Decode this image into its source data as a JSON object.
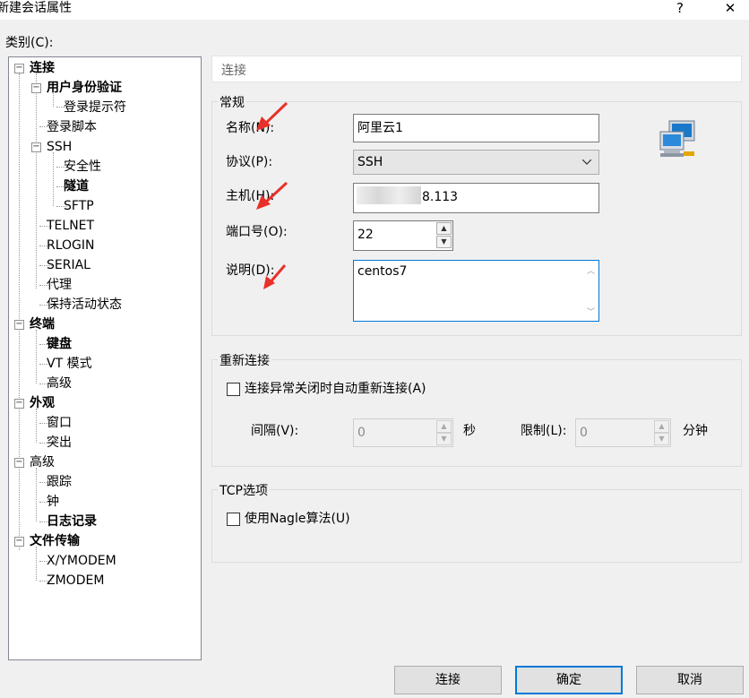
{
  "window": {
    "title": "新建会话属性",
    "help_glyph": "?",
    "close_glyph": "✕"
  },
  "category_label": "类别(C):",
  "tree": [
    {
      "label": "连接",
      "bold": true,
      "expander": "−"
    },
    {
      "label": "用户身份验证",
      "bold": true,
      "expander": "−"
    },
    {
      "label": "登录提示符",
      "bold": false
    },
    {
      "label": "登录脚本",
      "bold": false
    },
    {
      "label": "SSH",
      "bold": false,
      "expander": "−"
    },
    {
      "label": "安全性",
      "bold": false
    },
    {
      "label": "隧道",
      "bold": true
    },
    {
      "label": "SFTP",
      "bold": false
    },
    {
      "label": "TELNET",
      "bold": false
    },
    {
      "label": "RLOGIN",
      "bold": false
    },
    {
      "label": "SERIAL",
      "bold": false
    },
    {
      "label": "代理",
      "bold": false
    },
    {
      "label": "保持活动状态",
      "bold": false
    },
    {
      "label": "终端",
      "bold": true,
      "expander": "−"
    },
    {
      "label": "键盘",
      "bold": true
    },
    {
      "label": "VT 模式",
      "bold": false
    },
    {
      "label": "高级",
      "bold": false
    },
    {
      "label": "外观",
      "bold": true,
      "expander": "−"
    },
    {
      "label": "窗口",
      "bold": false
    },
    {
      "label": "突出",
      "bold": false
    },
    {
      "label": "高级",
      "bold": false,
      "expander": "−"
    },
    {
      "label": "跟踪",
      "bold": false
    },
    {
      "label": "钟",
      "bold": false
    },
    {
      "label": "日志记录",
      "bold": true
    },
    {
      "label": "文件传输",
      "bold": true,
      "expander": "−"
    },
    {
      "label": "X/YMODEM",
      "bold": false
    },
    {
      "label": "ZMODEM",
      "bold": false
    }
  ],
  "header": {
    "text": "连接"
  },
  "general": {
    "title": "常规",
    "name_label": "名称(N):",
    "name_value": "阿里云1",
    "protocol_label": "协议(P):",
    "protocol_value": "SSH",
    "host_label": "主机(H):",
    "host_value": "8.113",
    "port_label": "端口号(O):",
    "port_value": "22",
    "desc_label": "说明(D):",
    "desc_value": "centos7"
  },
  "reconnect": {
    "title": "重新连接",
    "checkbox_label": "连接异常关闭时自动重新连接(A)",
    "interval_label": "间隔(V):",
    "interval_value": "0",
    "interval_unit": "秒",
    "limit_label": "限制(L):",
    "limit_value": "0",
    "limit_unit": "分钟"
  },
  "tcp": {
    "title": "TCP选项",
    "checkbox_label": "使用Nagle算法(U)"
  },
  "buttons": {
    "connect": "连接",
    "ok": "确定",
    "cancel": "取消"
  },
  "colors": {
    "accent": "#0078d7",
    "annotation_arrow": "#e8302a"
  }
}
